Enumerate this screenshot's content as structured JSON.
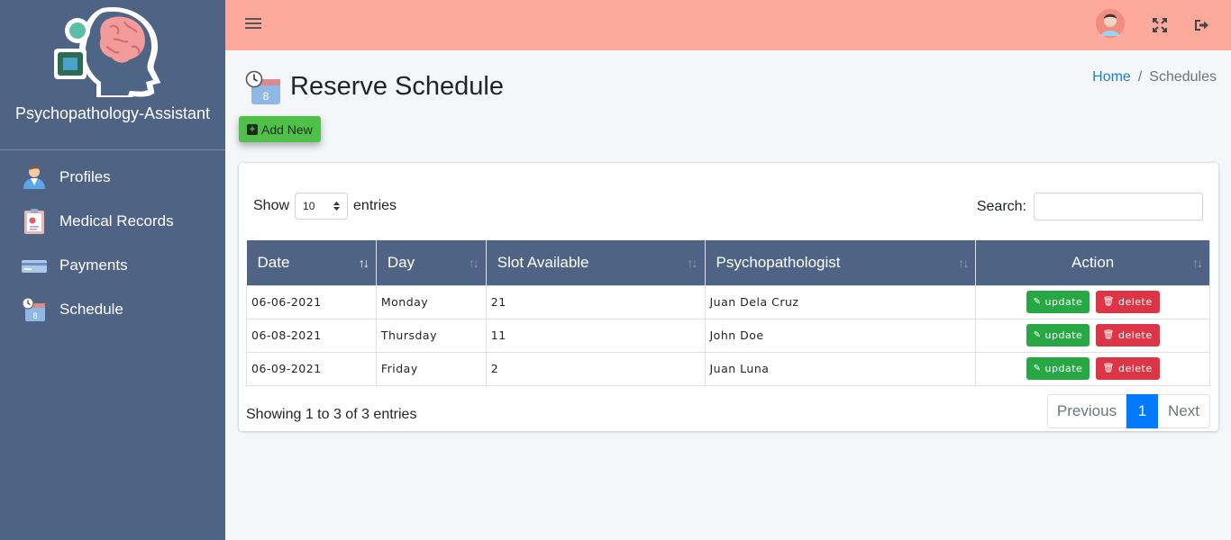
{
  "app": {
    "name": "Psychopathology-Assistant"
  },
  "sidebar": {
    "items": [
      {
        "label": "Profiles",
        "icon": "doctor-icon"
      },
      {
        "label": "Medical Records",
        "icon": "clipboard-icon"
      },
      {
        "label": "Payments",
        "icon": "credit-card-icon"
      },
      {
        "label": "Schedule",
        "icon": "calendar-clock-icon"
      }
    ]
  },
  "page": {
    "title": "Reserve Schedule"
  },
  "breadcrumb": {
    "home": "Home",
    "current": "Schedules"
  },
  "toolbar": {
    "add_label": "Add New"
  },
  "datatable": {
    "show_label": "Show",
    "entries_label": "entries",
    "page_length": "10",
    "search_label": "Search:",
    "search_value": "",
    "columns": [
      "Date",
      "Day",
      "Slot Available",
      "Psychopathologist",
      "Action"
    ],
    "rows": [
      {
        "date": "06-06-2021",
        "day": "Monday",
        "slots": "21",
        "psychopathologist": "Juan Dela Cruz"
      },
      {
        "date": "06-08-2021",
        "day": "Thursday",
        "slots": "11",
        "psychopathologist": "John Doe"
      },
      {
        "date": "06-09-2021",
        "day": "Friday",
        "slots": "2",
        "psychopathologist": "Juan Luna"
      }
    ],
    "update_label": "update",
    "delete_label": "delete",
    "info": "Showing 1 to 3 of 3 entries",
    "pagination": {
      "previous": "Previous",
      "current": "1",
      "next": "Next"
    }
  },
  "colors": {
    "sidebar": "#4f6385",
    "header": "#fdaa9d",
    "add_button": "#4fc148",
    "update_button": "#28a745",
    "delete_button": "#dc3545",
    "active_page": "#007bff"
  }
}
